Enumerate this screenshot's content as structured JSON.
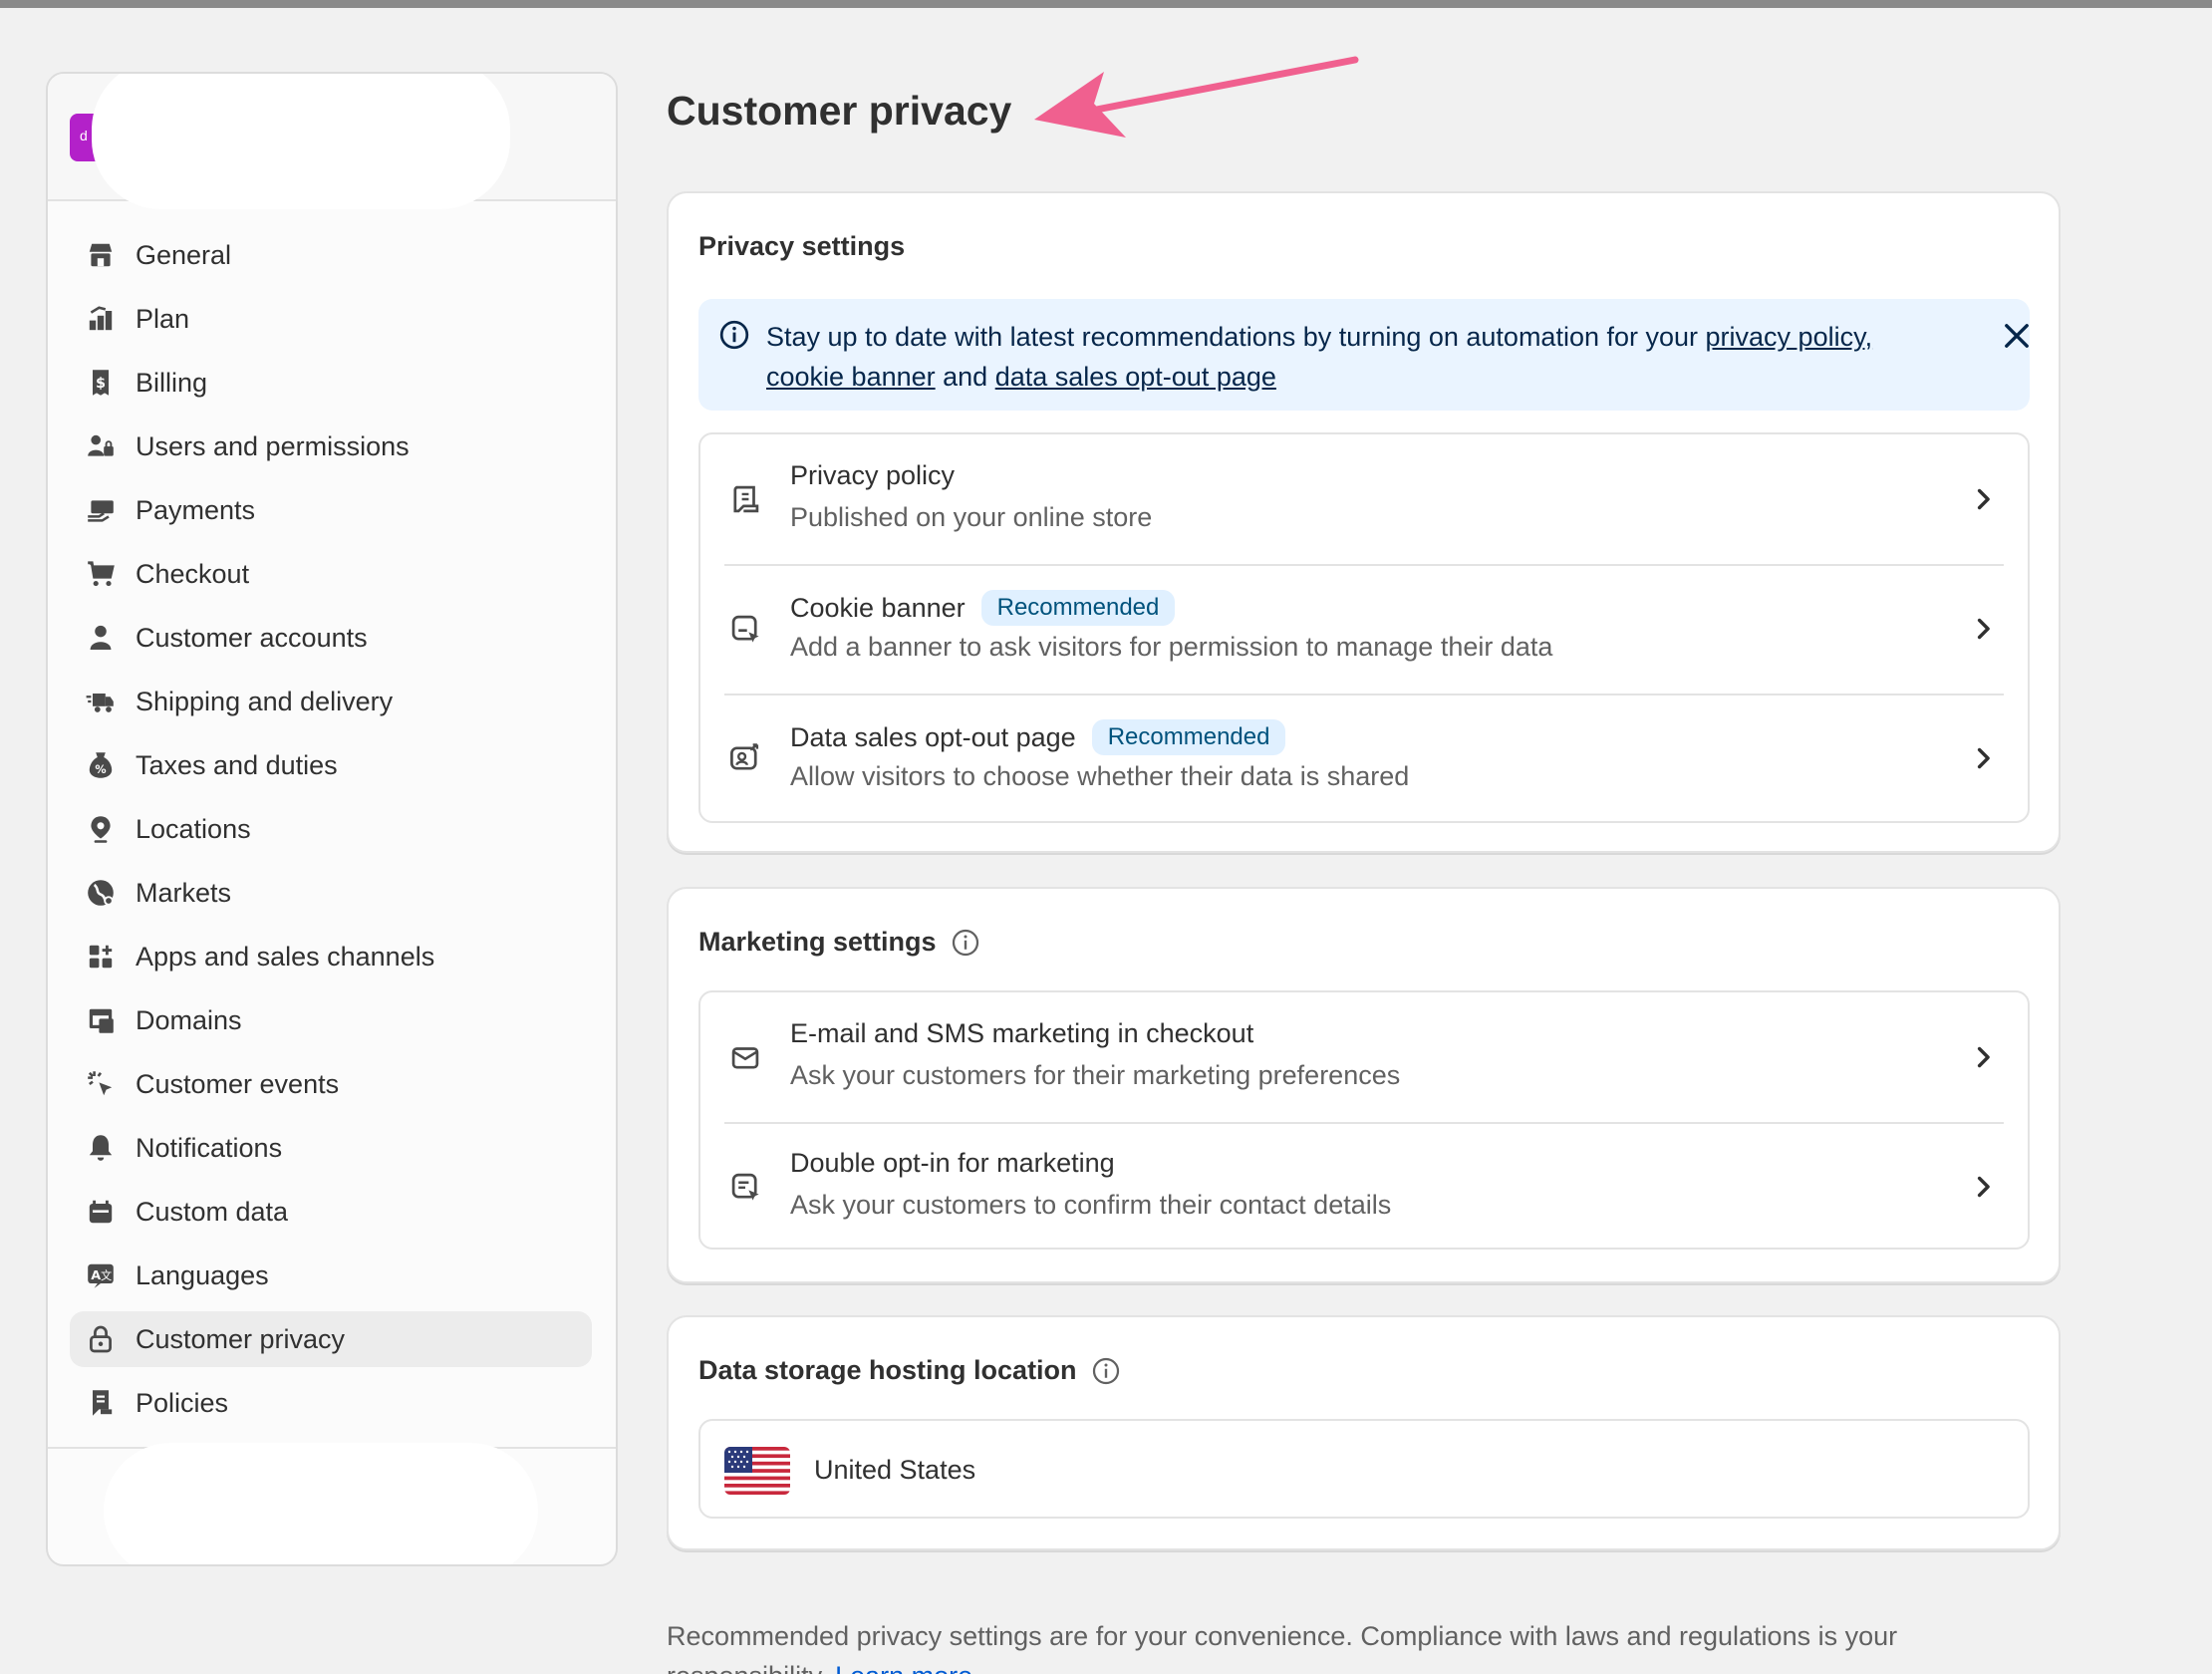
{
  "page": {
    "title": "Customer privacy"
  },
  "sidebar": {
    "store_logo_letter": "d",
    "items": [
      {
        "label": "General",
        "icon": "store-icon"
      },
      {
        "label": "Plan",
        "icon": "plan-icon"
      },
      {
        "label": "Billing",
        "icon": "billing-icon"
      },
      {
        "label": "Users and permissions",
        "icon": "users-icon"
      },
      {
        "label": "Payments",
        "icon": "payments-icon"
      },
      {
        "label": "Checkout",
        "icon": "cart-icon"
      },
      {
        "label": "Customer accounts",
        "icon": "person-icon"
      },
      {
        "label": "Shipping and delivery",
        "icon": "truck-icon"
      },
      {
        "label": "Taxes and duties",
        "icon": "tax-icon"
      },
      {
        "label": "Locations",
        "icon": "location-pin-icon"
      },
      {
        "label": "Markets",
        "icon": "globe-icon"
      },
      {
        "label": "Apps and sales channels",
        "icon": "apps-icon"
      },
      {
        "label": "Domains",
        "icon": "domains-icon"
      },
      {
        "label": "Customer events",
        "icon": "cursor-click-icon"
      },
      {
        "label": "Notifications",
        "icon": "bell-icon"
      },
      {
        "label": "Custom data",
        "icon": "database-icon"
      },
      {
        "label": "Languages",
        "icon": "translate-icon"
      },
      {
        "label": "Customer privacy",
        "icon": "lock-icon",
        "active": true
      },
      {
        "label": "Policies",
        "icon": "policies-icon"
      }
    ]
  },
  "privacy_settings": {
    "title": "Privacy settings",
    "banner": {
      "text_before": "Stay up to date with latest recommendations by turning on automation for your ",
      "link_privacy_policy": "privacy policy,",
      "link_cookie_banner": "cookie banner",
      "text_and": " and ",
      "link_opt_out": "data sales opt-out page"
    },
    "rows": [
      {
        "title": "Privacy policy",
        "subtitle": "Published on your online store",
        "badge": ""
      },
      {
        "title": "Cookie banner",
        "subtitle": "Add a banner to ask visitors for permission to manage their data",
        "badge": "Recommended"
      },
      {
        "title": "Data sales opt-out page",
        "subtitle": "Allow visitors to choose whether their data is shared",
        "badge": "Recommended"
      }
    ]
  },
  "marketing_settings": {
    "title": "Marketing settings",
    "rows": [
      {
        "title": "E-mail and SMS marketing in checkout",
        "subtitle": "Ask your customers for their marketing preferences"
      },
      {
        "title": "Double opt-in for marketing",
        "subtitle": "Ask your customers to confirm their contact details"
      }
    ]
  },
  "data_storage": {
    "title": "Data storage hosting location",
    "location": "United States"
  },
  "footnote": {
    "text": "Recommended privacy settings are for your convenience. Compliance with laws and regulations is your responsibility. ",
    "link": "Learn more"
  },
  "colors": {
    "annotation_arrow": "#f0608f",
    "badge_bg": "#e0f0ff",
    "banner_bg": "#eaf4ff",
    "link": "#005bd3",
    "store_logo": "#b321c9"
  }
}
